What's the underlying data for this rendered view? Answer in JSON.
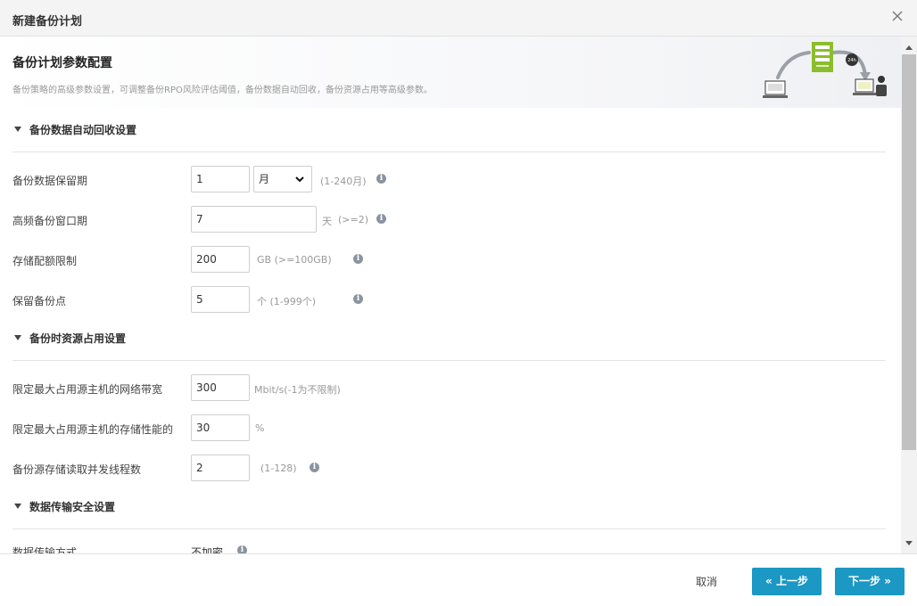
{
  "dialog": {
    "title": "新建备份计划"
  },
  "banner": {
    "title": "备份计划参数配置",
    "description": "备份策略的高级参数设置，可调整备份RPO风险评估阈值，备份数据自动回收，备份资源占用等高级参数。"
  },
  "sections": {
    "retention": {
      "title": "备份数据自动回收设置",
      "rows": {
        "retention_period": {
          "label": "备份数据保留期",
          "value": "1",
          "unit_selected": "月",
          "hint": "(1-240月)"
        },
        "high_freq_window": {
          "label": "高频备份窗口期",
          "value": "7",
          "unit": "天",
          "hint": "(>=2)"
        },
        "storage_quota": {
          "label": "存储配额限制",
          "value": "200",
          "hint": "GB (>=100GB)"
        },
        "keep_points": {
          "label": "保留备份点",
          "value": "5",
          "hint": "个 (1-999个)"
        }
      }
    },
    "resources": {
      "title": "备份时资源占用设置",
      "rows": {
        "bandwidth": {
          "label": "限定最大占用源主机的网络带宽",
          "value": "300",
          "hint": "Mbit/s(-1为不限制)"
        },
        "storage_perf": {
          "label": "限定最大占用源主机的存储性能的",
          "value": "30",
          "hint": "%"
        },
        "threads": {
          "label": "备份源存储读取并发线程数",
          "value": "2",
          "hint": "(1-128)"
        }
      }
    },
    "security": {
      "title": "数据传输安全设置",
      "rows": {
        "transfer_mode": {
          "label": "数据传输方式",
          "value": "不加密"
        }
      }
    }
  },
  "illustration": {
    "badge_text": "24h"
  },
  "footer": {
    "cancel_label": "取消",
    "prev_label": "« 上一步",
    "next_label": "下一步 »"
  },
  "colors": {
    "primary": "#1b98c4",
    "accent_green": "#8cbd2c",
    "info_icon": "#8a94a0"
  },
  "icons": {
    "close": "close-icon",
    "info": "info-icon",
    "caret": "caret-down-icon",
    "select": "chevron-down-icon"
  }
}
